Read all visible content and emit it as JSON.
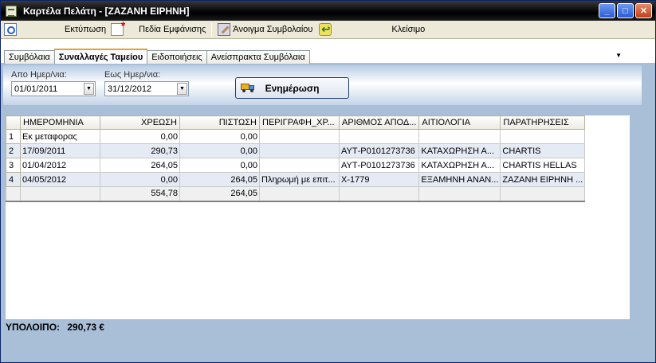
{
  "window": {
    "title": "Καρτέλα Πελάτη - [ΖΑΖΑΝΗ ΕΙΡΗΝΗ]"
  },
  "toolbar": {
    "print_label": "Εκτύπωση",
    "fields_label": "Πεδία Εμφάνισης",
    "open_contract_label": "Άνοιγμα Συμβολαίου",
    "close_label": "Κλείσιμο"
  },
  "tabs": [
    {
      "label": "Συμβόλαια"
    },
    {
      "label": "Συναλλαγές Ταμείου",
      "active": true
    },
    {
      "label": "Ειδοποιήσεις"
    },
    {
      "label": "Ανείσπρακτα Συμβόλαια"
    }
  ],
  "filters": {
    "from_label": "Απο Ημερ/νια:",
    "from_value": "01/01/2011",
    "to_label": "Εως Ημερ/νια:",
    "to_value": "31/12/2012",
    "refresh_label": "Ενημέρωση"
  },
  "grid": {
    "columns": [
      "ΗΜΕΡΟΜΗΝΙΑ",
      "ΧΡΕΩΣΗ",
      "ΠΙΣΤΩΣΗ",
      "ΠΕΡΙΓΡΑΦΗ_ΧΡ...",
      "ΑΡΙΘΜΟΣ ΑΠΟΔ...",
      "ΑΙΤΙΟΛΟΓΙΑ",
      "ΠΑΡΑΤΗΡΗΣΕΙΣ"
    ],
    "rows": [
      {
        "n": "1",
        "date": "Εκ μεταφορας",
        "debit": "0,00",
        "credit": "0,00",
        "desc": "",
        "receipt": "",
        "reason": "",
        "notes": ""
      },
      {
        "n": "2",
        "date": "17/09/2011",
        "debit": "290,73",
        "credit": "0,00",
        "desc": "",
        "receipt": "ΑΥΤ-Ρ0101273736",
        "reason": "ΚΑΤΑΧΩΡΗΣΗ Α...",
        "notes": "CHARTIS"
      },
      {
        "n": "3",
        "date": "01/04/2012",
        "debit": "264,05",
        "credit": "0,00",
        "desc": "",
        "receipt": "ΑΥΤ-Ρ0101273736",
        "reason": "ΚΑΤΑΧΩΡΗΣΗ Α...",
        "notes": "CHARTIS HELLAS"
      },
      {
        "n": "4",
        "date": "04/05/2012",
        "debit": "0,00",
        "credit": "264,05",
        "desc": "Πληρωμή με επιτ...",
        "receipt": "Χ-1779",
        "reason": "ΕΞΑΜΗΝΗ ΑΝΑΝ...",
        "notes": "ΖΑΖΑΝΗ ΕΙΡΗΝΗ ..."
      }
    ],
    "totals": {
      "debit": "554,78",
      "credit": "264,05"
    }
  },
  "balance": {
    "label": "ΥΠΟΛΟΙΠΟ:",
    "value": "290,73 €"
  }
}
